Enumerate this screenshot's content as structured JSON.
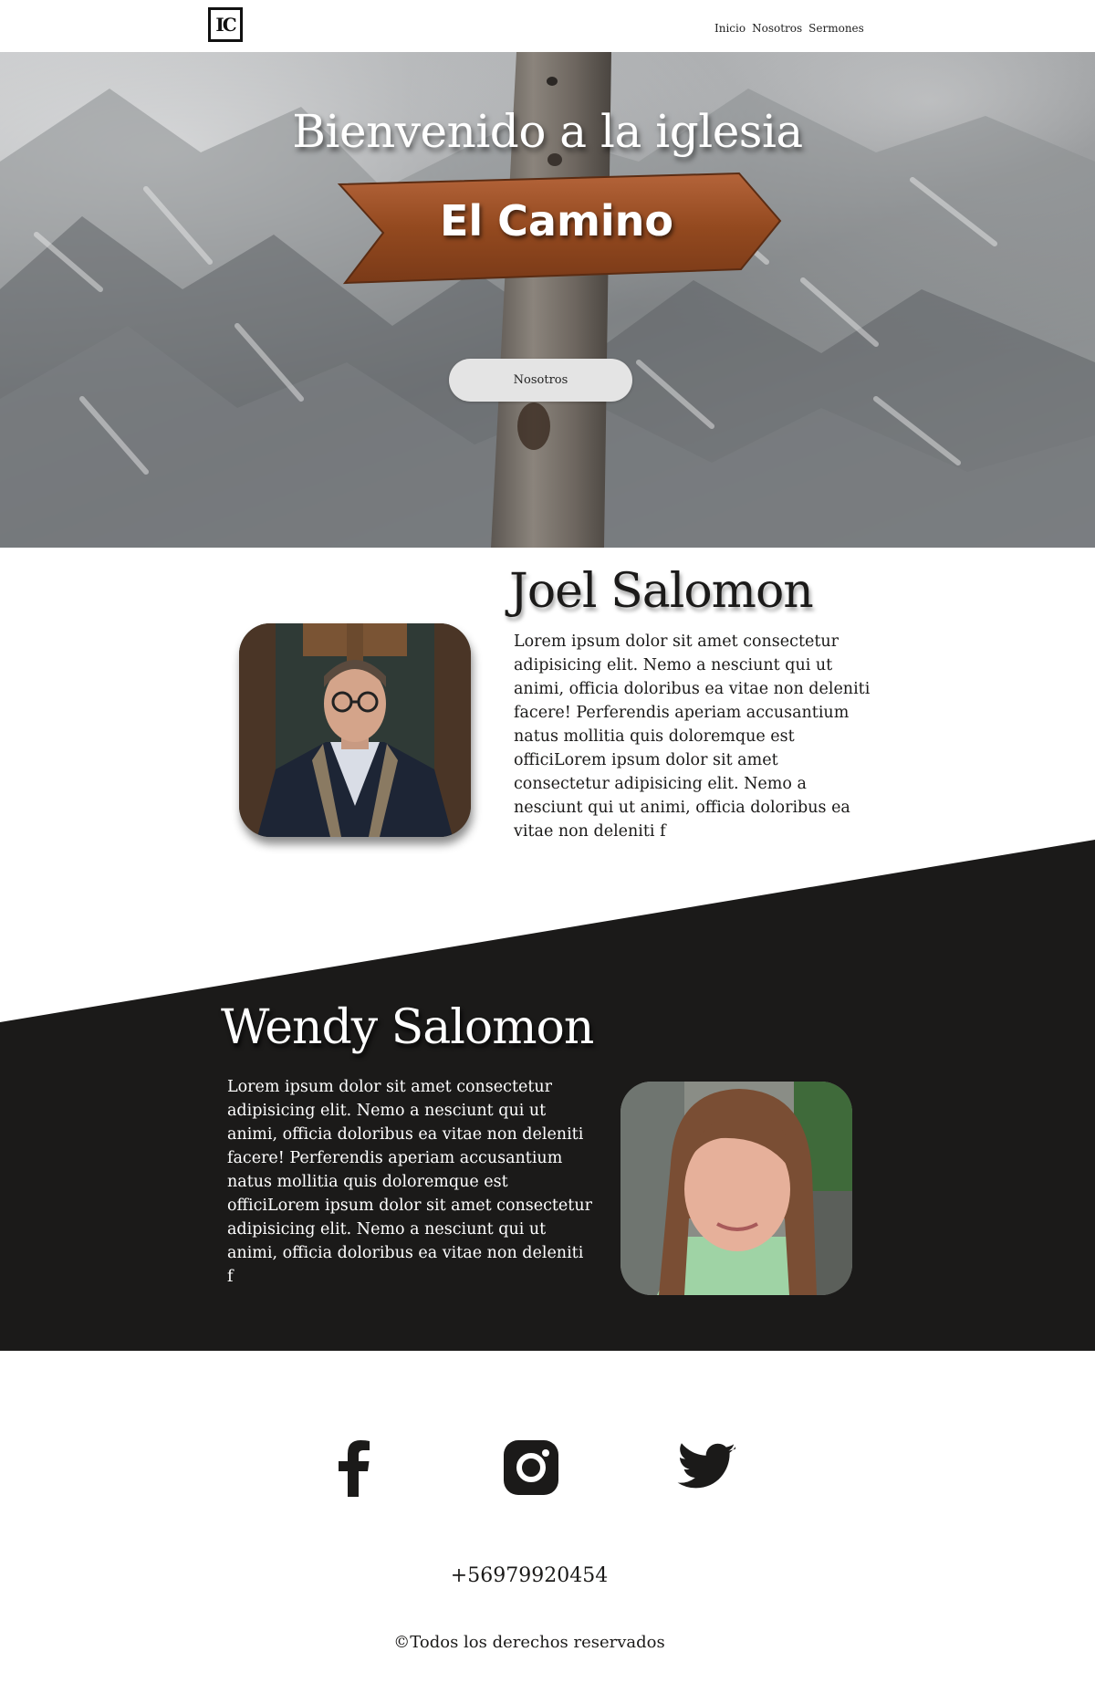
{
  "header": {
    "logo_text": "IC",
    "nav": [
      "Inicio",
      "Nosotros",
      "Sermones"
    ]
  },
  "hero": {
    "title": "Bienvenido a la iglesia",
    "sign_text": "El Camino",
    "button_label": "Nosotros"
  },
  "people": [
    {
      "name": "Joel Salomon",
      "bio": "Lorem ipsum dolor sit amet consectetur adipisicing elit. Nemo a nesciunt qui ut animi, officia doloribus ea vitae non deleniti facere! Perferendis aperiam accusantium natus mollitia quis doloremque est officiLorem ipsum dolor sit amet consectetur adipisicing elit. Nemo a nesciunt qui ut animi, officia doloribus ea vitae non deleniti f"
    },
    {
      "name": "Wendy Salomon",
      "bio": "Lorem ipsum dolor sit amet consectetur adipisicing elit. Nemo a nesciunt qui ut animi, officia doloribus ea vitae non deleniti facere! Perferendis aperiam accusantium natus mollitia quis doloremque est officiLorem ipsum dolor sit amet consectetur adipisicing elit. Nemo a nesciunt qui ut animi, officia doloribus ea vitae non deleniti f"
    }
  ],
  "social": {
    "icons": [
      "facebook-icon",
      "instagram-icon",
      "twitter-icon"
    ]
  },
  "footer": {
    "phone": "+56979920454",
    "copyright": "©Todos los derechos reservados"
  },
  "colors": {
    "dark_section": "#1b1a19",
    "hero_button": "#e4e4e4",
    "sign_wood": "#9a4f26"
  }
}
